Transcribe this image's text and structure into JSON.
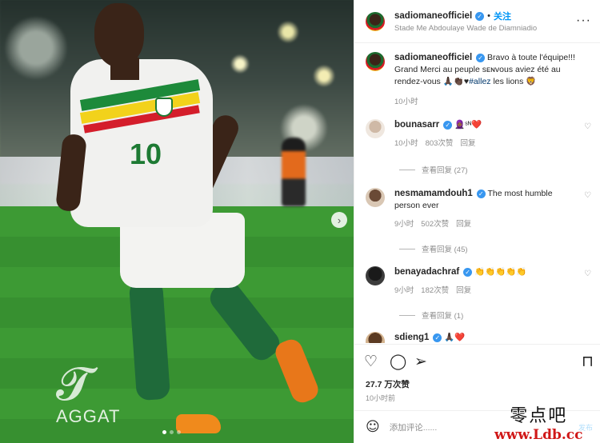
{
  "post": {
    "username": "sadiomaneofficiel",
    "follow_label": "关注",
    "separator": "•",
    "location": "Stade Me Abdoulaye Wade de Diamniadio",
    "more_icon": "more-horizontal-icon",
    "photo": {
      "jersey_number": "10",
      "watermark": "AGGAT",
      "carousel_dots": 3,
      "active_dot": 1
    }
  },
  "caption": {
    "username": "sadiomaneofficiel",
    "text": "Bravo à toute l'équipe!!! Grand Merci au peuple sᴇɴvous aviez été au rendez-vous 🙏🏿👏🏿♥",
    "hashtag": "#allez",
    "text_after": " les lions 🦁",
    "time": "10小时"
  },
  "comments": [
    {
      "username": "bounasarr",
      "text": "🧕🏾ˢᴺ❤️",
      "time": "10小时",
      "likes": "803次赞",
      "reply": "回复",
      "view_replies": "查看回复 (27)"
    },
    {
      "username": "nesmamamdouh1",
      "text": "The most humble person ever",
      "time": "9小时",
      "likes": "502次赞",
      "reply": "回复",
      "view_replies": "查看回复 (45)"
    },
    {
      "username": "benayadachraf",
      "text": "👏👏👏👏👏",
      "time": "9小时",
      "likes": "182次赞",
      "reply": "回复",
      "view_replies": "查看回复 (1)"
    },
    {
      "username": "sdieng1",
      "text": "🙏🏿❤️"
    }
  ],
  "actions": {
    "like_icon": "heart-icon",
    "comment_icon": "comment-bubble-icon",
    "share_icon": "paper-plane-icon",
    "save_icon": "bookmark-icon",
    "likes_count": "27.7 万次赞",
    "posted_ago": "10小时前"
  },
  "add_comment": {
    "placeholder": "添加评论......",
    "post_label": "发布"
  },
  "site_watermark": {
    "cn": "零点吧",
    "url": "www.Ldb.cc"
  },
  "colors": {
    "verified_blue": "#3897f0",
    "link_blue": "#0095f6",
    "muted_gray": "#8e8e8e",
    "text": "#262626"
  }
}
